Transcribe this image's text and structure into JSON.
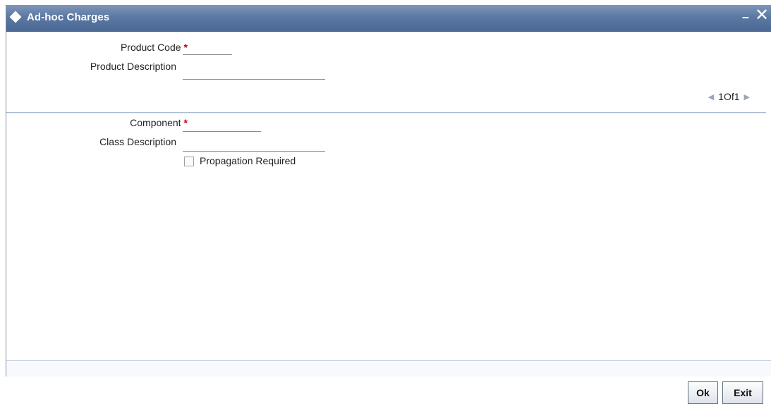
{
  "window": {
    "title": "Ad-hoc Charges",
    "minimize_glyph": "–",
    "close_glyph": "✕"
  },
  "header": {
    "product_code_label": "Product Code",
    "product_code_value": "",
    "product_description_label": "Product Description",
    "product_description_value": "",
    "required_marker": "*"
  },
  "pager": {
    "text": "1Of1",
    "prev_icon": "◀",
    "next_icon": "▶"
  },
  "detail": {
    "component_label": "Component",
    "component_value": "",
    "class_description_label": "Class Description",
    "class_description_value": "",
    "propagation_label": "Propagation Required",
    "propagation_checked": false
  },
  "actions": {
    "ok_label": "Ok",
    "exit_label": "Exit"
  }
}
